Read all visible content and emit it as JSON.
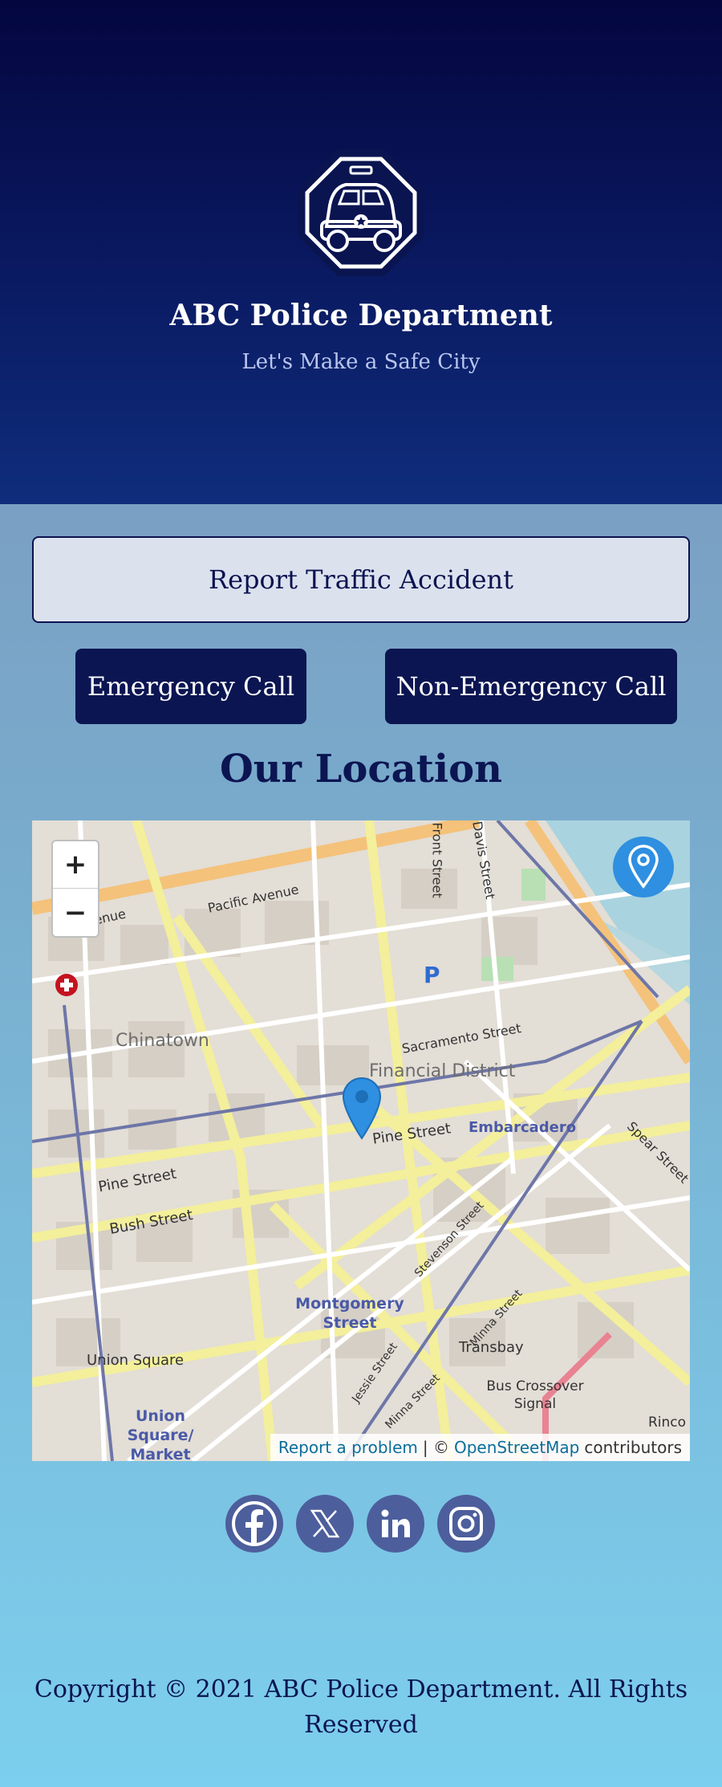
{
  "header": {
    "org_name": "ABC Police Department",
    "tagline": "Let's Make a Safe City"
  },
  "actions": {
    "report_label": "Report Traffic Accident",
    "emergency_label": "Emergency Call",
    "non_emergency_label": "Non-Emergency Call"
  },
  "location": {
    "title": "Our Location",
    "map": {
      "zoom_in_label": "+",
      "zoom_out_label": "−",
      "labels": {
        "pacific_avenue": "Pacific Avenue",
        "pacific_avenue_short": "c Avenue",
        "front_street": "Front Street",
        "davis_street": "Davis Street",
        "parking": "P",
        "chinatown": "Chinatown",
        "sacramento_street": "Sacramento Street",
        "financial_district": "Financial District",
        "pine_street_east": "Pine Street",
        "embarcadero": "Embarcadero",
        "spear_street": "Spear Street",
        "pine_street_west": "Pine Street",
        "bush_street": "Bush Street",
        "stevenson_street": "Stevenson Street",
        "montgomery_street": "Montgomery Street",
        "minna_street_east": "Minna Street",
        "transbay": "Transbay",
        "union_square": "Union Square",
        "jessie_street": "Jessie Street",
        "minna_street_west": "Minna Street",
        "bus_crossover": "Bus Crossover Signal",
        "union_square_market": "Union Square/ Market",
        "rincon": "Rinco"
      },
      "attribution": {
        "report_problem": "Report a problem",
        "separator": "| ©",
        "osm": "OpenStreetMap",
        "contributors": "contributors"
      }
    }
  },
  "social": {
    "facebook": "facebook-icon",
    "x": "x-icon",
    "linkedin": "linkedin-icon",
    "instagram": "instagram-icon"
  },
  "footer": {
    "copyright": "Copyright © 2021 ABC Police Department. All Rights Reserved"
  },
  "colors": {
    "hero_top": "#04063f",
    "navy": "#0b1552",
    "map_pin": "#2f8fe0",
    "social": "#4d5e9c"
  }
}
